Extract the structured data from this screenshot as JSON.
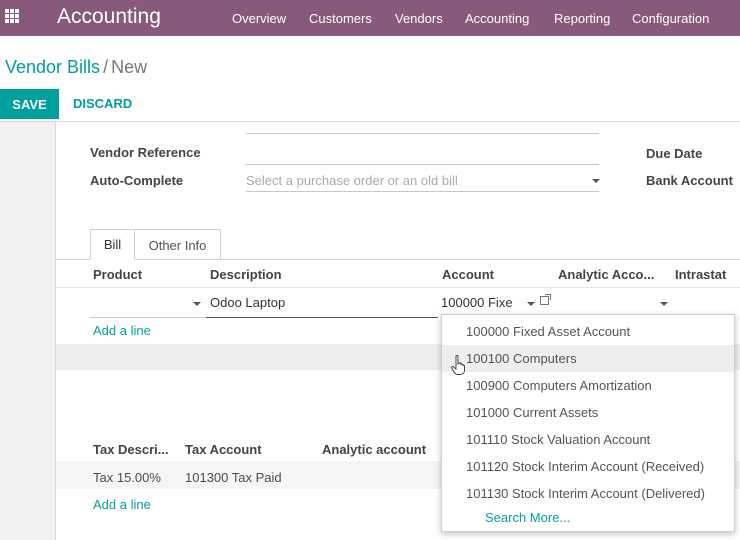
{
  "nav": {
    "app_name": "Accounting",
    "menu": [
      "Overview",
      "Customers",
      "Vendors",
      "Accounting",
      "Reporting",
      "Configuration"
    ]
  },
  "breadcrumb": {
    "parent": "Vendor Bills",
    "separator": "/",
    "current": "New"
  },
  "buttons": {
    "save": "SAVE",
    "discard": "DISCARD"
  },
  "form": {
    "vendor_reference_label": "Vendor Reference",
    "auto_complete_label": "Auto-Complete",
    "auto_complete_placeholder": "Select a purchase order or an old bill",
    "due_date_label": "Due Date",
    "bank_account_label": "Bank Account"
  },
  "tabs": [
    "Bill",
    "Other Info"
  ],
  "lines": {
    "headers": [
      "Product",
      "Description",
      "Account",
      "Analytic Acco...",
      "Intrastat"
    ],
    "row": {
      "product": "",
      "description": "Odoo Laptop",
      "account": "100000 Fixe"
    },
    "add_line": "Add a line"
  },
  "taxes": {
    "headers": [
      "Tax Descri...",
      "Tax Account",
      "Analytic account"
    ],
    "row": {
      "description": "Tax 15.00%",
      "account": "101300 Tax Paid"
    },
    "add_line": "Add a line"
  },
  "account_dropdown": {
    "options": [
      "100000 Fixed Asset Account",
      "100100 Computers",
      "100900 Computers Amortization",
      "101000 Current Assets",
      "101110 Stock Valuation Account",
      "101120 Stock Interim Account (Received)",
      "101130 Stock Interim Account (Delivered)"
    ],
    "hovered_option": "100100 Computers",
    "search_more": "Search More..."
  },
  "colors": {
    "brand": "#875a7b",
    "accent": "#00a09d"
  }
}
